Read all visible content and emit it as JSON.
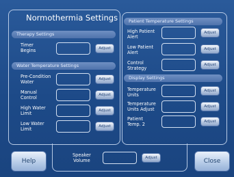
{
  "header": {
    "title": "Normothermia Settings"
  },
  "adjust_label": "Adjust",
  "therapy": {
    "title": "Therapy Settings",
    "timer_begins": "Timer\nBegins"
  },
  "water": {
    "title": "Water Temperature Settings",
    "pre_condition": "Pre-Condition\nWater",
    "manual_control": "Manual\nControl",
    "high_water": "High Water\nLimit",
    "low_water": "Low Water\nLimit"
  },
  "patient": {
    "title": "Patient Temperature Settings",
    "high_alert": "High Patient\nAlert",
    "low_alert": "Low Patient\nAlert",
    "control_strategy": "Control\nStrategy"
  },
  "display": {
    "title": "Display Settings",
    "temp_units": "Temperature\nUnits",
    "temp_units_adjust": "Temperature\nUnits Adjust",
    "patient_temp2": "Patient\nTemp. 2"
  },
  "footer": {
    "help": "Help",
    "speaker_volume": "Speaker\nVolume",
    "close": "Close"
  }
}
